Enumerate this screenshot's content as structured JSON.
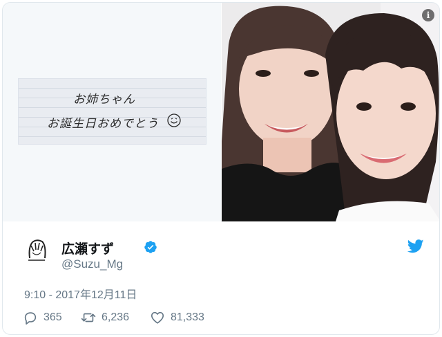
{
  "media": {
    "note_line_1": "お姉ちゃん",
    "note_line_2": "お誕生日おめでとう",
    "info_icon": "info-icon",
    "info_glyph": "i"
  },
  "author": {
    "display_name": "広瀬すず",
    "handle": "@Suzu_Mg",
    "verified_icon": "verified-badge-icon",
    "brand_icon": "twitter-bird-icon"
  },
  "tweet": {
    "timestamp": "9:10 - 2017年12月11日"
  },
  "actions": {
    "reply_count": "365",
    "retweet_count": "6,236",
    "like_count": "81,333"
  },
  "colors": {
    "brand_blue": "#1da1f2",
    "secondary_text": "#657786",
    "border": "#e1e8ed"
  }
}
